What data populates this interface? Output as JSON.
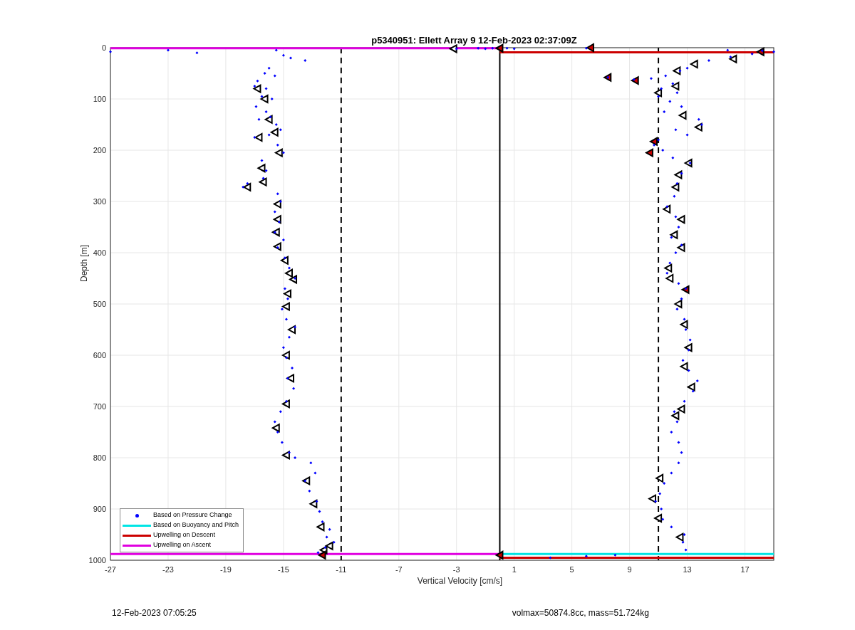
{
  "figure": {
    "footer_left": "12-Feb-2023 07:05:25",
    "footer_right": "volmax=50874.8cc, mass=51.724kg"
  },
  "chart_data": {
    "type": "scatter",
    "title": "p5340951: Ellett Array 9 12-Feb-2023 02:37:09Z",
    "xlabel": "Vertical Velocity [cm/s]",
    "ylabel": "Depth [m]",
    "xlim": [
      -27,
      19
    ],
    "ylim": [
      1000,
      0
    ],
    "xticks": [
      -27,
      -23,
      -19,
      -15,
      -11,
      -7,
      -3,
      1,
      5,
      9,
      13,
      17
    ],
    "yticks": [
      0,
      100,
      200,
      300,
      400,
      500,
      600,
      700,
      800,
      900,
      1000
    ],
    "series": [
      {
        "name": "Based on Pressure Change",
        "type": "scatter",
        "color": "#0000ff",
        "x": [
          -15,
          -14.5,
          -13.5,
          -16,
          -16.3,
          -15.6,
          -16.8,
          -17,
          -16.2,
          -16.5,
          -15.8,
          -16.9,
          -16.2,
          -15.9,
          -16.7,
          -15.5,
          -15.2,
          -16,
          -17,
          -15.4,
          -15,
          -16.5,
          -16.2,
          -16.4,
          -17.5,
          -17.8,
          -15.4,
          -15.2,
          -15.6,
          -15.3,
          -15.6,
          -15,
          -15.4,
          -14.9,
          -14.6,
          -14.2,
          -14.9,
          -14.7,
          -15.1,
          -14.8,
          -14.2,
          -14.6,
          -15,
          -14.8,
          -14.4,
          -14.7,
          -14.3,
          -14.8,
          -15.2,
          -15.6,
          -15.4,
          -15.1,
          -14.6,
          -14.2,
          -13.1,
          -12.8,
          -13.5,
          -13.2,
          -12.7,
          -12.5,
          -12.3,
          -11.8,
          -12,
          -11.5,
          -12.1,
          -12.6,
          -27,
          -23,
          -21,
          -15.5,
          -3,
          -1.5,
          -1,
          -0.5,
          0.5,
          1,
          6,
          15.8,
          18.2,
          19,
          17.5,
          16,
          14.5,
          13,
          12.5,
          11.5,
          7.5,
          9.3,
          10.5,
          12,
          11.2,
          12.3,
          11,
          11.8,
          12.6,
          11.4,
          13.8,
          14,
          12.2,
          13,
          11,
          10.7,
          11.3,
          12,
          13.2,
          12.6,
          12.3,
          12.1,
          11.6,
          12.2,
          12.4,
          11.9,
          12.6,
          12.2,
          11.8,
          11.6,
          12.4,
          12.9,
          12.6,
          12.3,
          12.8,
          12.9,
          13.2,
          13.1,
          12.7,
          13.1,
          13.7,
          13.4,
          12.8,
          12.1,
          12.3,
          11.9,
          12.4,
          12.6,
          12.4,
          11.9,
          11.4,
          11.1,
          10.8,
          11.2,
          11.3,
          11.9,
          12.8,
          12.7,
          12.9,
          3.5,
          6,
          8
        ],
        "values": [
          15,
          20,
          25,
          40,
          50,
          55,
          65,
          75,
          80,
          95,
          100,
          115,
          125,
          135,
          140,
          150,
          160,
          170,
          175,
          190,
          205,
          220,
          240,
          255,
          265,
          272,
          285,
          300,
          320,
          340,
          360,
          375,
          390,
          410,
          430,
          450,
          470,
          490,
          510,
          530,
          545,
          565,
          585,
          605,
          625,
          645,
          665,
          690,
          710,
          730,
          750,
          770,
          790,
          800,
          810,
          830,
          845,
          865,
          885,
          905,
          925,
          940,
          955,
          965,
          975,
          985,
          8,
          5,
          10,
          5,
          2,
          1,
          2,
          1,
          1,
          2,
          1,
          5,
          6,
          8,
          12,
          18,
          25,
          40,
          45,
          55,
          58,
          62,
          60,
          70,
          80,
          88,
          95,
          105,
          115,
          125,
          140,
          150,
          160,
          170,
          180,
          190,
          200,
          215,
          225,
          245,
          265,
          290,
          310,
          330,
          350,
          370,
          385,
          400,
          420,
          440,
          460,
          470,
          490,
          510,
          530,
          550,
          570,
          590,
          610,
          630,
          650,
          670,
          690,
          710,
          730,
          750,
          770,
          790,
          810,
          830,
          850,
          870,
          885,
          900,
          920,
          935,
          950,
          965,
          980,
          995,
          992,
          990
        ]
      },
      {
        "name": "Based on Buoyancy and Pitch",
        "type": "line",
        "color": "#00e5e5",
        "x": [
          0,
          19
        ],
        "values": [
          988,
          988
        ]
      },
      {
        "name": "Upwelling on Descent",
        "type": "line",
        "color": "#cc0000",
        "x": [
          0,
          19
        ],
        "values": [
          9,
          9
        ]
      },
      {
        "name": "Upwelling on Ascent",
        "type": "line",
        "color": "#e000e0",
        "x": [
          -27,
          0
        ],
        "values": [
          1,
          1
        ]
      },
      {
        "type": "line",
        "color": "#cc0000",
        "x": [
          0,
          19
        ],
        "values": [
          995,
          995
        ]
      },
      {
        "type": "line",
        "color": "#e000e0",
        "x": [
          -27,
          0
        ],
        "values": [
          988,
          988
        ]
      },
      {
        "type": "scatter",
        "color": "#ffffff",
        "x": [
          -16.8,
          -16.3,
          -16,
          -15.6,
          -16.7,
          -15.3,
          -16.5,
          -16.4,
          -17.5,
          -15.4,
          -15.4,
          -15.5,
          -15.4,
          -14.9,
          -14.6,
          -14.3,
          -14.7,
          -14.8,
          -14.4,
          -14.8,
          -14.5,
          -14.8,
          -15.5,
          -14.8,
          -13.4,
          -12.9,
          -12.4,
          -11.8,
          -12.2,
          -3.2,
          16.2,
          13.5,
          12.3,
          12.2,
          11,
          12.7,
          13.8,
          13.1,
          12.4,
          12.2,
          11.6,
          12.6,
          12.1,
          12.6,
          11.7,
          11.8,
          12.4,
          12.8,
          13.1,
          12.8,
          13.3,
          12.6,
          12.2,
          11.1,
          10.6,
          11,
          12.5
        ],
        "values": [
          80,
          100,
          140,
          165,
          175,
          205,
          235,
          262,
          272,
          305,
          335,
          360,
          388,
          415,
          440,
          452,
          480,
          505,
          550,
          600,
          645,
          695,
          742,
          795,
          845,
          890,
          935,
          972,
          980,
          2,
          22,
          32,
          45,
          75,
          88,
          132,
          155,
          225,
          248,
          272,
          315,
          335,
          365,
          390,
          430,
          450,
          500,
          540,
          585,
          622,
          662,
          705,
          718,
          840,
          880,
          918,
          955
        ]
      },
      {
        "type": "scatter",
        "color": "#cc0000",
        "x": [
          6.3,
          18.1,
          7.5,
          9.4,
          10.7,
          10.4,
          12.9,
          -12.3,
          0,
          0
        ],
        "values": [
          0,
          8,
          58,
          64,
          183,
          205,
          472,
          990,
          990,
          1
        ]
      }
    ],
    "ref_lines": [
      {
        "axis": "x",
        "value": 0
      },
      {
        "axis": "x",
        "value": -11
      },
      {
        "axis": "x",
        "value": 11
      }
    ],
    "grid": true,
    "legend": true
  }
}
